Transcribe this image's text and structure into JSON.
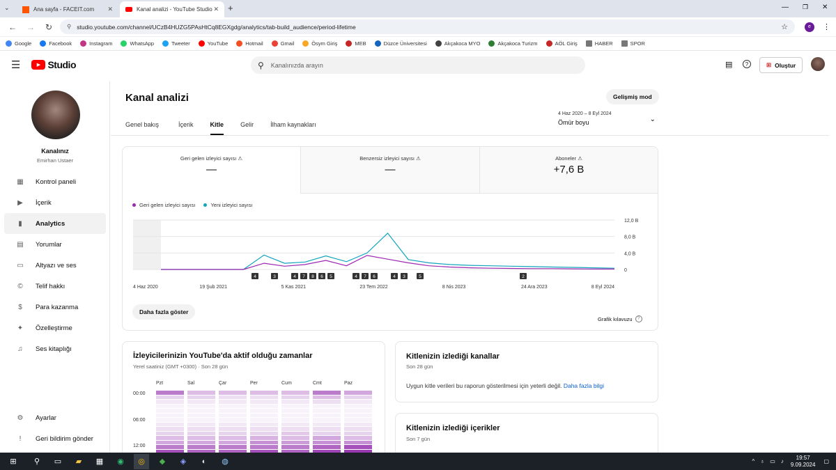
{
  "browser": {
    "tabs": [
      {
        "title": "Ana sayfa - FACEIT.com",
        "active": false
      },
      {
        "title": "Kanal analizi - YouTube Studio",
        "active": true
      }
    ],
    "url": "studio.youtube.com/channel/UCzB4HUZG5PAsHtCq8EGXgdg/analytics/tab-build_audience/period-lifetime",
    "profile_initial": "e",
    "bookmarks": [
      "Google",
      "Facebook",
      "Instagram",
      "WhatsApp",
      "Tweeter",
      "YouTube",
      "Hotmail",
      "Gmail",
      "Ösym Giriş",
      "MEB",
      "Düzce Üniversitesi",
      "Akçakoca MYO",
      "Akçakoca Turizm",
      "AÖL Giriş",
      "HABER",
      "SPOR"
    ]
  },
  "header": {
    "logo_text": "Studio",
    "search_placeholder": "Kanalınızda arayın",
    "create_label": "Oluştur"
  },
  "sidebar": {
    "channel_label": "Kanalınız",
    "channel_name": "Emirhan Ustaer",
    "items": [
      {
        "label": "Kontrol paneli",
        "icon": "dashboard-icon"
      },
      {
        "label": "İçerik",
        "icon": "content-icon"
      },
      {
        "label": "Analytics",
        "icon": "analytics-icon",
        "active": true
      },
      {
        "label": "Yorumlar",
        "icon": "comments-icon"
      },
      {
        "label": "Altyazı ve ses",
        "icon": "subtitles-icon"
      },
      {
        "label": "Telif hakkı",
        "icon": "copyright-icon"
      },
      {
        "label": "Para kazanma",
        "icon": "dollar-icon"
      },
      {
        "label": "Özelleştirme",
        "icon": "magic-wand-icon"
      },
      {
        "label": "Ses kitaplığı",
        "icon": "audio-library-icon"
      }
    ],
    "bottom": [
      {
        "label": "Ayarlar",
        "icon": "gear-icon"
      },
      {
        "label": "Geri bildirim gönder",
        "icon": "feedback-icon"
      }
    ]
  },
  "analytics": {
    "title": "Kanal analizi",
    "advanced_mode": "Gelişmiş mod",
    "tabs": [
      "Genel bakış",
      "İçerik",
      "Kitle",
      "Gelir",
      "İlham kaynakları"
    ],
    "active_tab": "Kitle",
    "date_range": "4 Haz 2020 – 8 Eyl 2024",
    "period": "Ömür boyu",
    "metrics": [
      {
        "label": "Geri gelen izleyici sayısı",
        "value": "—"
      },
      {
        "label": "Benzersiz izleyici sayısı",
        "value": "—"
      },
      {
        "label": "Aboneler",
        "value": "+7,6 B"
      }
    ],
    "legend": [
      {
        "name": "Geri gelen izleyici sayısı",
        "color": "#9c27b0"
      },
      {
        "name": "Yeni izleyici sayısı",
        "color": "#12a4bd"
      }
    ],
    "more_button": "Daha fazla göster",
    "chart_guide": "Grafik kılavuzu"
  },
  "chart_data": {
    "type": "line",
    "x": [
      "4 Haz 2020",
      "19 Şub 2021",
      "5 Kas 2021",
      "23 Tem 2022",
      "8 Nis 2023",
      "24 Ara 2023",
      "8 Eyl 2024"
    ],
    "y_ticks": [
      "12,0 B",
      "8,0 B",
      "4,0 B",
      "0"
    ],
    "ylim": [
      0,
      12000
    ],
    "series": [
      {
        "name": "Geri gelen izleyici sayısı",
        "color": "#9c27b0",
        "values": [
          0,
          0,
          0,
          0,
          0,
          1500,
          800,
          1200,
          2200,
          900,
          3400,
          2500,
          1600,
          900,
          600,
          400,
          300,
          250,
          200,
          200,
          150,
          100,
          100
        ]
      },
      {
        "name": "Yeni izleyici sayısı",
        "color": "#12a4bd",
        "values": [
          0,
          0,
          0,
          0,
          0,
          3500,
          1500,
          1800,
          3300,
          1900,
          4000,
          8800,
          2400,
          1600,
          1200,
          1000,
          900,
          800,
          700,
          600,
          500,
          400,
          300
        ]
      }
    ],
    "markers": [
      "4",
      "3",
      "4",
      "7",
      "8",
      "6",
      "5",
      "4",
      "7",
      "6",
      "4",
      "3",
      "5",
      "2"
    ]
  },
  "active_times": {
    "title": "İzleyicilerinizin YouTube'da aktif olduğu zamanlar",
    "subtitle": "Yerel saatiniz (GMT +0300) · Son 28 gün",
    "days": [
      "Pzt",
      "Sal",
      "Çar",
      "Per",
      "Cum",
      "Cmt",
      "Paz"
    ],
    "hours": [
      "00:00",
      "06:00",
      "12:00"
    ],
    "intensity": [
      [
        0.6,
        0.2,
        0.1,
        0.05,
        0.05,
        0.05,
        0.05,
        0.1,
        0.15,
        0.2,
        0.3,
        0.4,
        0.6,
        0.8
      ],
      [
        0.3,
        0.2,
        0.1,
        0.05,
        0.05,
        0.05,
        0.05,
        0.1,
        0.15,
        0.2,
        0.3,
        0.4,
        0.6,
        0.7
      ],
      [
        0.3,
        0.15,
        0.1,
        0.05,
        0.05,
        0.05,
        0.05,
        0.1,
        0.15,
        0.2,
        0.3,
        0.4,
        0.6,
        0.7
      ],
      [
        0.3,
        0.15,
        0.1,
        0.05,
        0.05,
        0.05,
        0.05,
        0.1,
        0.15,
        0.2,
        0.35,
        0.5,
        0.6,
        0.8
      ],
      [
        0.3,
        0.2,
        0.1,
        0.05,
        0.05,
        0.05,
        0.05,
        0.1,
        0.15,
        0.25,
        0.3,
        0.45,
        0.6,
        0.7
      ],
      [
        0.6,
        0.3,
        0.15,
        0.05,
        0.05,
        0.05,
        0.05,
        0.1,
        0.15,
        0.2,
        0.4,
        0.5,
        0.7,
        0.85
      ],
      [
        0.4,
        0.2,
        0.1,
        0.05,
        0.05,
        0.05,
        0.05,
        0.1,
        0.15,
        0.2,
        0.3,
        0.5,
        0.8,
        0.9
      ]
    ]
  },
  "channels_card": {
    "title": "Kitlenizin izlediği kanallar",
    "subtitle": "Son 28 gün",
    "message": "Uygun kitle verileri bu raporun gösterilmesi için yeterli değil.",
    "link": "Daha fazla bilgi"
  },
  "content_card": {
    "title": "Kitlenizin izlediği içerikler",
    "subtitle": "Son 7 gün"
  },
  "taskbar": {
    "time": "19:57",
    "date": "9.09.2024"
  }
}
